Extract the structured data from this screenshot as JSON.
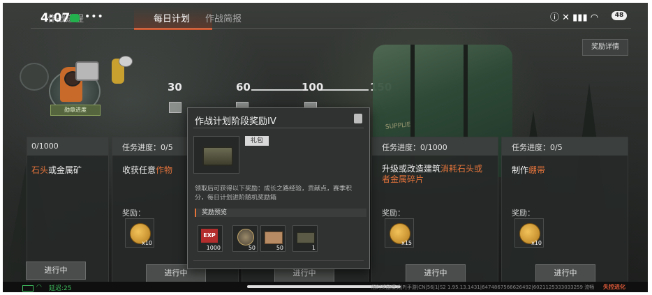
{
  "status_bar": {
    "time": "4:07",
    "dots": "•••",
    "battery": "48"
  },
  "tabs": [
    {
      "label": "作战进程"
    },
    {
      "label": "每日计划"
    },
    {
      "label": "作战简报"
    }
  ],
  "reward_details_button": "奖励详情",
  "avatar": {
    "rank_label": "勋章进度"
  },
  "milestones": [
    "30",
    "60",
    "100",
    "150"
  ],
  "crate_stencil": "SUPPLIE",
  "cards": [
    {
      "progress": "0/1000",
      "title_hl": "石头",
      "title_rest": "或金属矿",
      "reward_label": "",
      "coin_qty": "",
      "button": "进行中"
    },
    {
      "progress": "任务进度：0/5",
      "title_plain": "收获任意",
      "title_hl": "作物",
      "reward_label": "奖励：",
      "coin_qty": "x10",
      "button": "进行中"
    },
    {
      "button": "进行中"
    },
    {
      "progress": "任务进度：0/1000",
      "title_plain": "升级或改造建筑",
      "title_hl": "消耗石头或者金属碎片",
      "reward_label": "奖励：",
      "coin_qty": "x15",
      "button": "进行中"
    },
    {
      "progress": "任务进度：0/5",
      "title_plain": "制作",
      "title_hl": "绷带",
      "reward_label": "奖励：",
      "coin_qty": "x10",
      "button": "进行中"
    }
  ],
  "popup": {
    "title": "作战计划阶段奖励IV",
    "tag": "礼包",
    "description": "领取后可获得以下奖励：成长之路经验，贡献点，赛季积分，每日计划进阶随机奖励箱",
    "preview_label": "奖励预览",
    "items": [
      {
        "name": "EXP",
        "qty": "1000"
      },
      {
        "name": "medal",
        "qty": "50"
      },
      {
        "name": "supply-box",
        "qty": "50"
      },
      {
        "name": "chest",
        "qty": "1"
      }
    ]
  },
  "bottom_bar": {
    "delay": "延迟:25",
    "info": "限时奖励模式|P|手游|CN|56|1|S2   1.95.13.1431|6474867566626492|6021125333033259   流畅",
    "brand": "失控进化"
  }
}
